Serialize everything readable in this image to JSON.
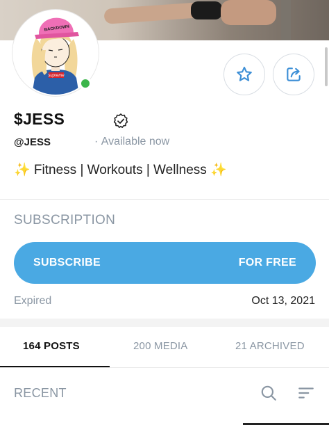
{
  "profile": {
    "name": "$JESS",
    "handle": "@JESS",
    "status": "Available now",
    "bio": "✨ Fitness | Workouts | Wellness ✨",
    "avatar_cap_text": "BACKDOWN",
    "avatar_shirt_text": "supreme"
  },
  "actions": {
    "favorite_icon": "star-icon",
    "share_icon": "share-icon"
  },
  "subscription": {
    "title": "SUBSCRIPTION",
    "button_left": "SUBSCRIBE",
    "button_right": "FOR FREE",
    "expired_label": "Expired",
    "expired_date": "Oct 13, 2021"
  },
  "tabs": [
    {
      "label": "164 POSTS",
      "active": true
    },
    {
      "label": "200 MEDIA",
      "active": false
    },
    {
      "label": "21 ARCHIVED",
      "active": false
    }
  ],
  "feed": {
    "section_label": "RECENT"
  },
  "colors": {
    "accent": "#4aa9e3",
    "muted": "#8a96a3",
    "online": "#3bb54a"
  }
}
